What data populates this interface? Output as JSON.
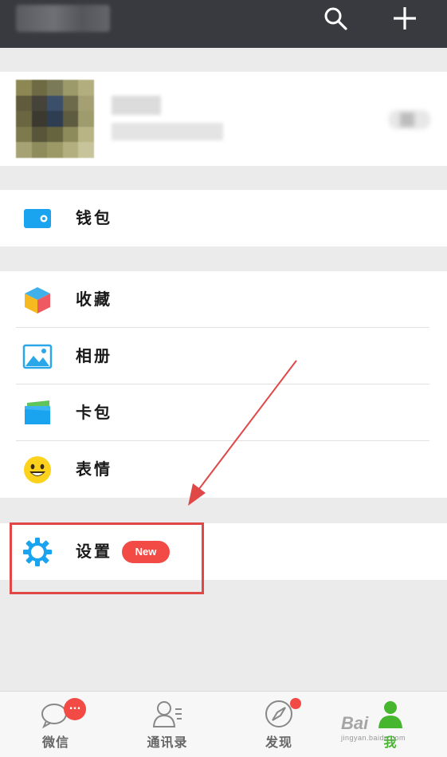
{
  "topbar": {
    "icons": [
      "search-icon",
      "plus-icon"
    ],
    "background": "#393a3f"
  },
  "menu": {
    "wallet": {
      "label": "钱包",
      "icon": "wallet-icon"
    },
    "favorites": {
      "label": "收藏",
      "icon": "cube-icon"
    },
    "album": {
      "label": "相册",
      "icon": "picture-icon"
    },
    "cards": {
      "label": "卡包",
      "icon": "card-wallet-icon"
    },
    "stickers": {
      "label": "表情",
      "icon": "smiley-icon"
    },
    "settings": {
      "label": "设置",
      "icon": "gear-icon",
      "badge": "New"
    }
  },
  "tabbar": {
    "tabs": [
      {
        "label": "微信",
        "icon": "chat-bubble-icon",
        "badge": "..."
      },
      {
        "label": "通讯录",
        "icon": "contacts-icon"
      },
      {
        "label": "发现",
        "icon": "compass-icon"
      },
      {
        "label": "我",
        "icon": "person-icon",
        "active": true
      }
    ]
  },
  "watermark": {
    "text": "Bai",
    "sub": "jingyan.baidu.com"
  },
  "colors": {
    "accent_green": "#46b62f",
    "badge_red": "#f24b45",
    "highlight_red": "#e04848"
  }
}
